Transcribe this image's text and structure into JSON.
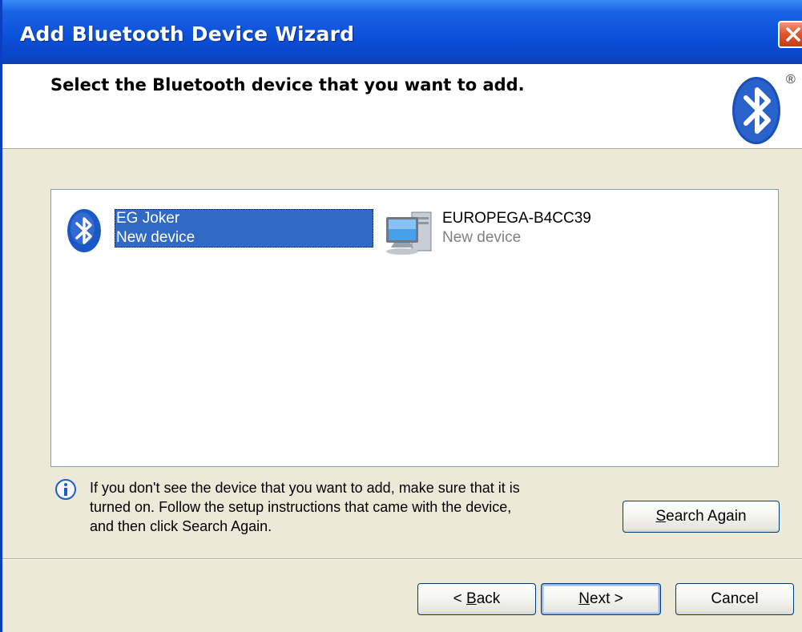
{
  "window": {
    "title": "Add Bluetooth Device Wizard"
  },
  "header": {
    "heading": "Select the Bluetooth device that you want to add.",
    "logo_icon": "bluetooth-logo-icon",
    "logo_mark": "®"
  },
  "devices": [
    {
      "name": "EG Joker",
      "status": "New device",
      "icon": "bluetooth-device-icon",
      "selected": true
    },
    {
      "name": "EUROPEGA-B4CC39",
      "status": "New device",
      "icon": "computer-icon",
      "selected": false
    }
  ],
  "info": {
    "icon": "info-icon",
    "line1": "If you don't see the device that you want to add, make sure that it is",
    "line2": "turned on. Follow the setup instructions that came with the device,",
    "line3": "and then click Search Again."
  },
  "buttons": {
    "search_again": {
      "accel": "S",
      "rest": "earch Again"
    },
    "back": {
      "prefix": "< ",
      "accel": "B",
      "rest": "ack"
    },
    "next": {
      "accel": "N",
      "rest": "ext >"
    },
    "cancel": "Cancel"
  },
  "colors": {
    "titlebar": "#0a47c9",
    "selection": "#316ac5",
    "dialog_bg": "#ece9d8",
    "close_button": "#e2552f"
  }
}
